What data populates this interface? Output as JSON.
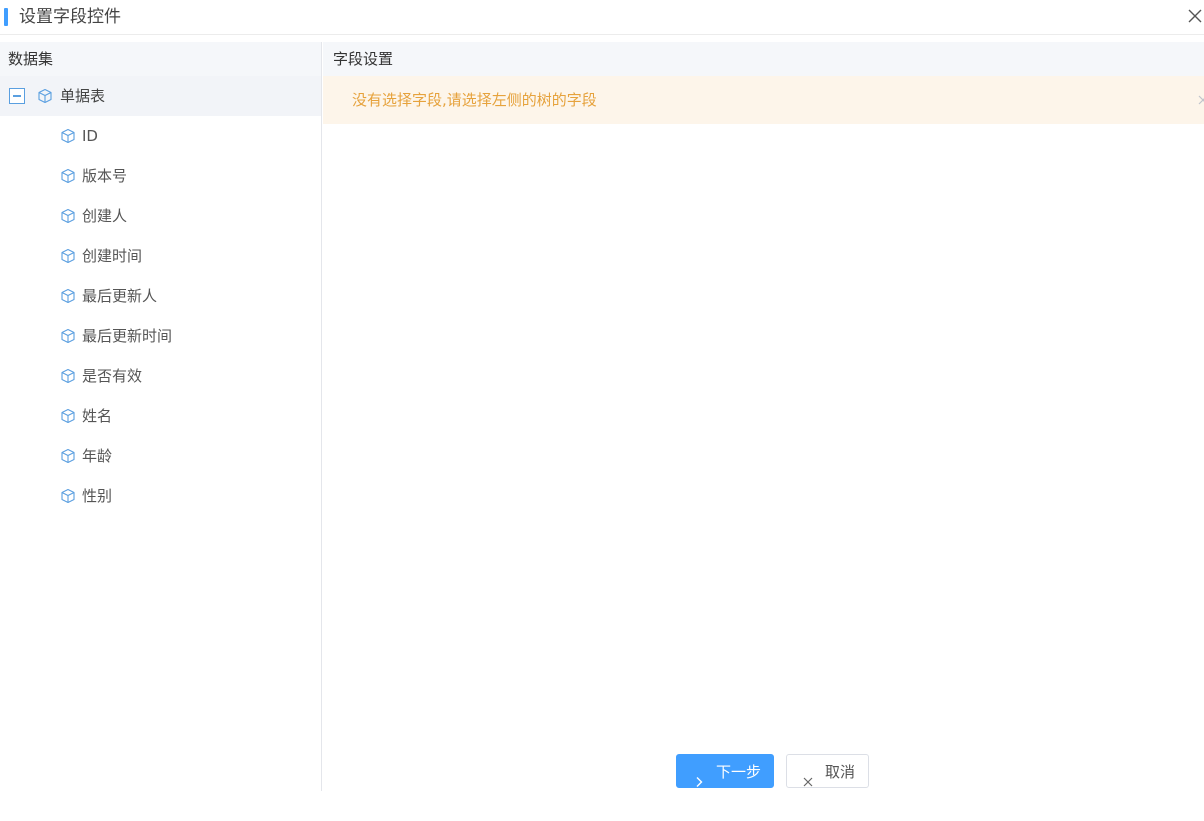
{
  "dialog": {
    "title": "设置字段控件",
    "accent_color": "#409eff"
  },
  "left_pane": {
    "header": "数据集",
    "root": {
      "label": "单据表",
      "expanded": true,
      "icon": "cube-icon"
    },
    "fields": [
      {
        "label": "ID",
        "icon": "cube-icon"
      },
      {
        "label": "版本号",
        "icon": "cube-icon"
      },
      {
        "label": "创建人",
        "icon": "cube-icon"
      },
      {
        "label": "创建时间",
        "icon": "cube-icon"
      },
      {
        "label": "最后更新人",
        "icon": "cube-icon"
      },
      {
        "label": "最后更新时间",
        "icon": "cube-icon"
      },
      {
        "label": "是否有效",
        "icon": "cube-icon"
      },
      {
        "label": "姓名",
        "icon": "cube-icon"
      },
      {
        "label": "年龄",
        "icon": "cube-icon"
      },
      {
        "label": "性别",
        "icon": "cube-icon"
      }
    ]
  },
  "right_pane": {
    "header": "字段设置",
    "alert": {
      "text": "没有选择字段,请选择左侧的树的字段",
      "color": "#e6a23c",
      "background": "#fdf5ea"
    }
  },
  "footer": {
    "next_label": "下一步",
    "next_icon": "chevron-right-icon",
    "cancel_label": "取消",
    "cancel_icon": "close-icon"
  }
}
